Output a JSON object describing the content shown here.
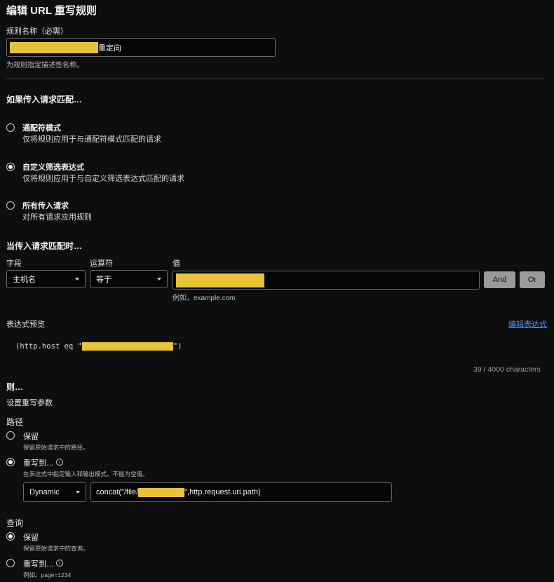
{
  "page": {
    "title": "编辑 URL 重写规则"
  },
  "rule_name": {
    "label": "规则名称（必需）",
    "value_suffix": "重定向",
    "help": "为规则指定描述性名称。"
  },
  "match_section": {
    "heading": "如果传入请求匹配…",
    "options": [
      {
        "title": "通配符模式",
        "desc": "仅将规则应用于与通配符模式匹配的请求",
        "selected": false
      },
      {
        "title": "自定义筛选表达式",
        "desc": "仅将规则应用于与自定义筛选表达式匹配的请求",
        "selected": true
      },
      {
        "title": "所有传入请求",
        "desc": "对所有请求应用规则",
        "selected": false
      }
    ]
  },
  "when_section": {
    "heading": "当传入请求匹配时…",
    "field_label": "字段",
    "operator_label": "运算符",
    "value_label": "值",
    "field_value": "主机名",
    "operator_value": "等于",
    "value_help": "例如，example.com",
    "and_label": "And",
    "or_label": "Or"
  },
  "expression": {
    "label": "表达式预览",
    "edit_link": "编辑表达式",
    "text_prefix": "(http.host eq \"",
    "text_suffix": "\")",
    "count": "39 / 4000 characters"
  },
  "then_section": {
    "heading": "则…",
    "subheading": "设置重写参数"
  },
  "path": {
    "label": "路径",
    "preserve_title": "保留",
    "preserve_desc": "保留原始请求中的路径。",
    "rewrite_title": "重写到…",
    "rewrite_desc": "在表达式中指定输入和输出模式。不能为空值。",
    "mode": "Dynamic",
    "expr_prefix": "concat(\"/file/",
    "expr_suffix": "\",http.request.uri.path)"
  },
  "query": {
    "label": "查询",
    "preserve_title": "保留",
    "preserve_desc": "保留原始请求中的查询。",
    "rewrite_title": "重写到…",
    "rewrite_desc": "例如。page=1234"
  },
  "colors": {
    "background": "#0e0e0e",
    "redaction": "#e8c23b",
    "link": "#4d8ef5",
    "button": "#9a9a9a"
  }
}
